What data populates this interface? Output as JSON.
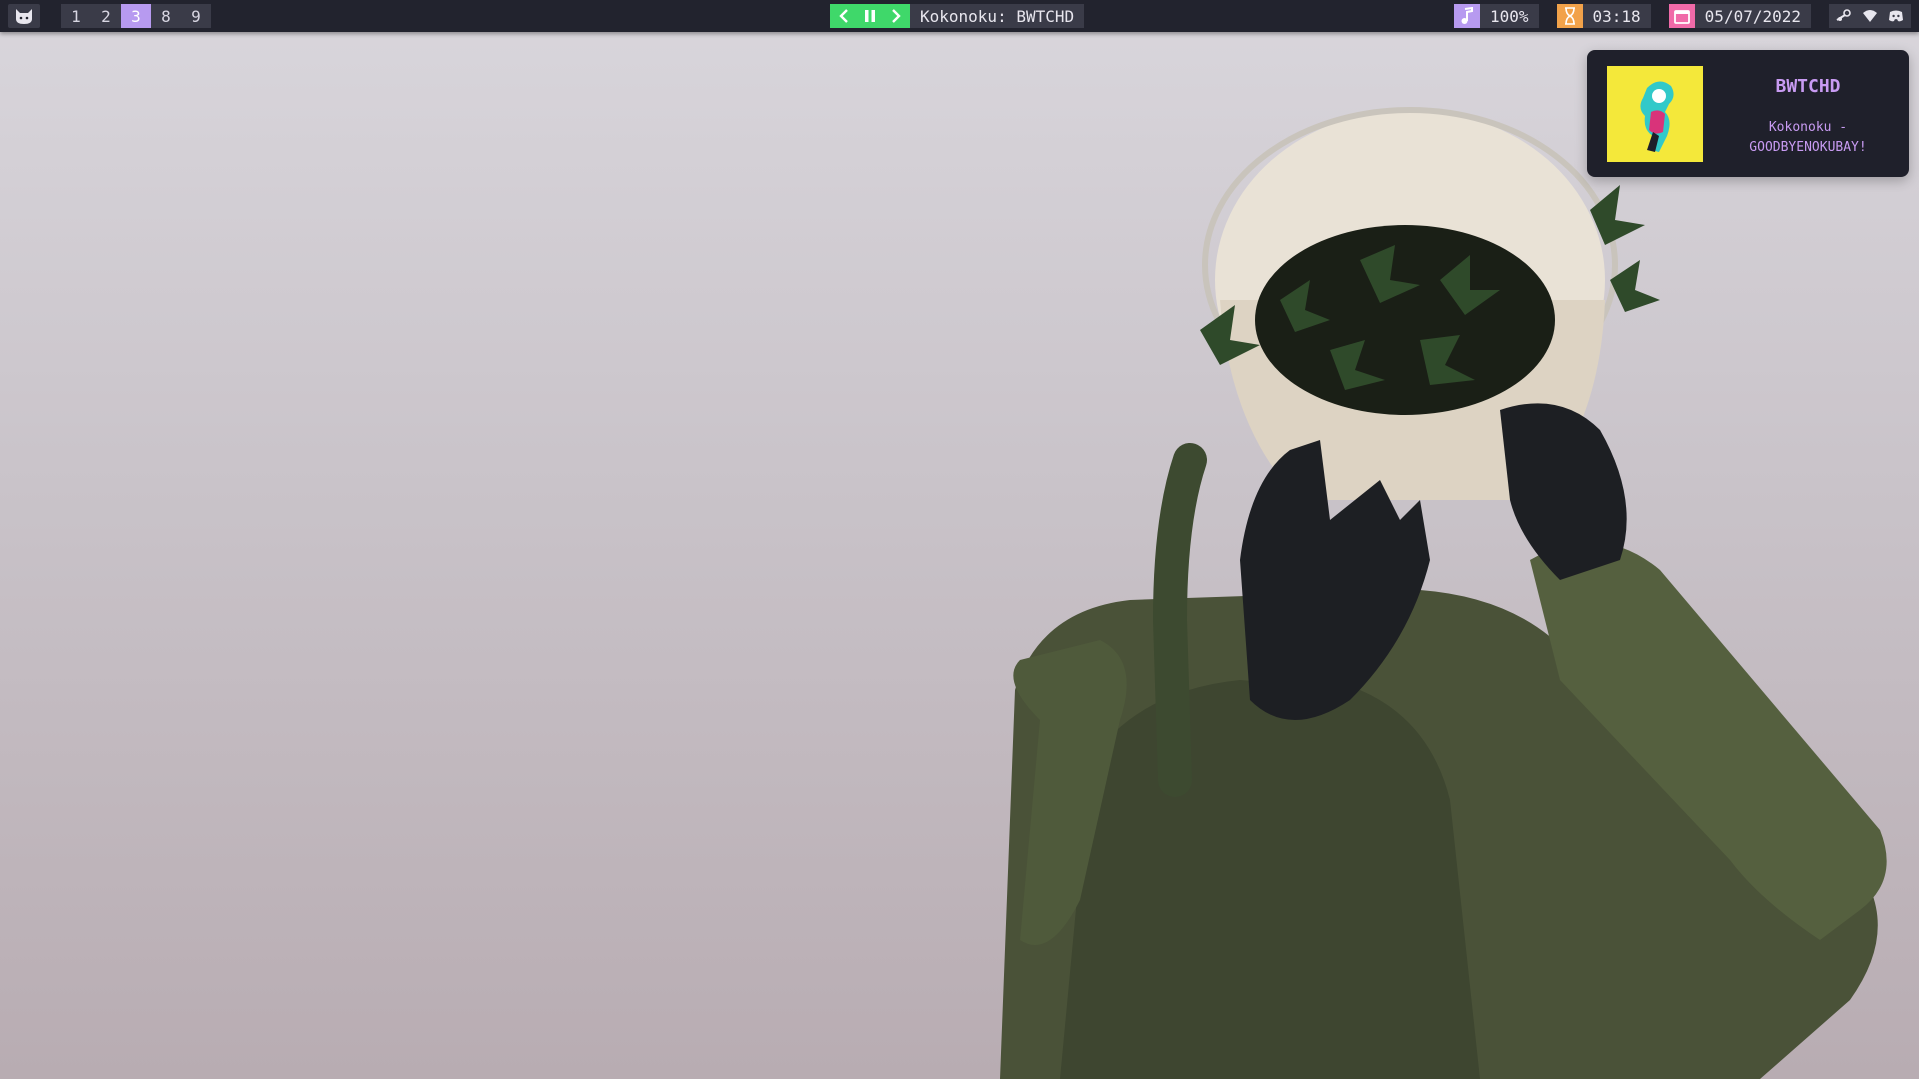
{
  "topbar": {
    "launcher_icon": "cat-icon",
    "workspaces": [
      {
        "label": "1",
        "active": false
      },
      {
        "label": "2",
        "active": false
      },
      {
        "label": "3",
        "active": true
      },
      {
        "label": "8",
        "active": false
      },
      {
        "label": "9",
        "active": false
      }
    ],
    "media": {
      "prev_icon": "chevron-left-icon",
      "pause_icon": "pause-icon",
      "next_icon": "chevron-right-icon",
      "now_playing": "Kokonoku: BWTCHD",
      "accent": "#3fd86a"
    },
    "volume": {
      "icon": "music-note-icon",
      "value": "100%",
      "accent": "#b79af0"
    },
    "clock": {
      "icon": "hourglass-icon",
      "value": "03:18",
      "accent": "#f2a24a"
    },
    "date": {
      "icon": "calendar-icon",
      "value": "05/07/2022",
      "accent": "#f06aa8"
    },
    "tray": [
      "steam-icon",
      "wifi-icon",
      "discord-icon"
    ]
  },
  "notification": {
    "title": "BWTCHD",
    "body_line1": "Kokonoku -",
    "body_line2": "GOODBYENOKUBAY!",
    "art_icon": "album-art-image",
    "accent": "#c89bf2"
  },
  "wallpaper": {
    "icon": "astronaut-ivy-wallpaper"
  }
}
